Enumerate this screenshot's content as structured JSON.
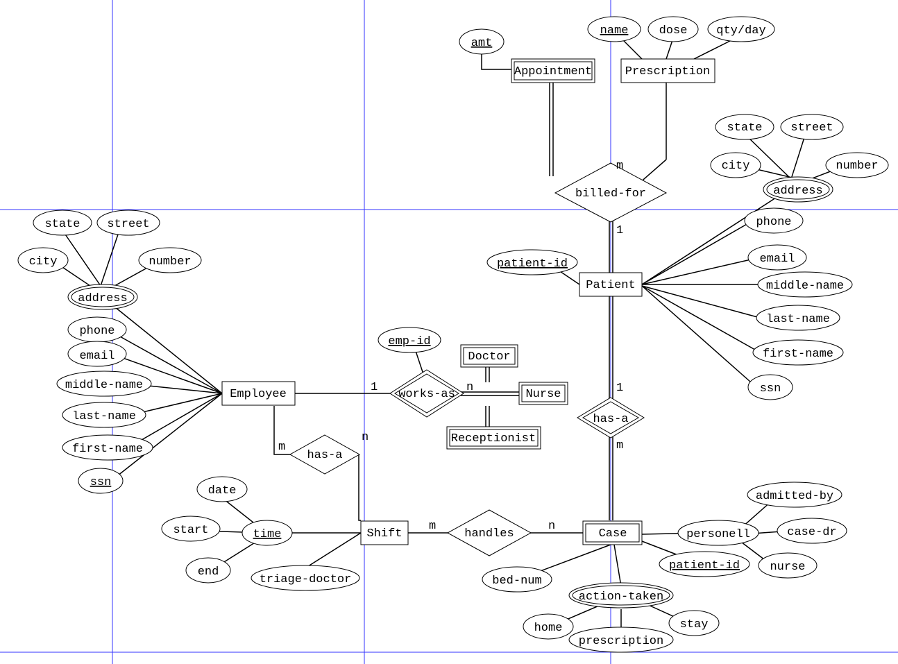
{
  "entities": {
    "appointment": "Appointment",
    "prescription": "Prescription",
    "employee": "Employee",
    "patient": "Patient",
    "shift": "Shift",
    "case": "Case",
    "doctor": "Doctor",
    "nurse": "Nurse",
    "receptionist": "Receptionist"
  },
  "relationships": {
    "billed_for": "billed-for",
    "works_as": "works-as",
    "has_a_emp": "has-a",
    "has_a_pat": "has-a",
    "handles": "handles"
  },
  "attributes": {
    "amt": "amt",
    "name": "name",
    "dose": "dose",
    "qty_day": "qty/day",
    "state1": "state",
    "street1": "street",
    "city1": "city",
    "number1": "number",
    "address1": "address",
    "phone1": "phone",
    "email1": "email",
    "middle_name1": "middle-name",
    "last_name1": "last-name",
    "first_name1": "first-name",
    "ssn1": "ssn",
    "patient_id": "patient-id",
    "state2": "state",
    "street2": "street",
    "city2": "city",
    "number2": "number",
    "address2": "address",
    "phone2": "phone",
    "email2": "email",
    "middle_name2": "middle-name",
    "last_name2": "last-name",
    "first_name2": "first-name",
    "ssn2": "ssn",
    "emp_id": "emp-id",
    "date": "date",
    "start": "start",
    "end": "end",
    "time": "time",
    "triage_doctor": "triage-doctor",
    "bed_num": "bed-num",
    "personell": "personell",
    "admitted_by": "admitted-by",
    "case_dr": "case-dr",
    "nurse_attr": "nurse",
    "patient_id2": "patient-id",
    "action_taken": "action-taken",
    "home": "home",
    "prescription_attr": "prescription",
    "stay": "stay"
  },
  "cardinalities": {
    "m1": "m",
    "one1": "1",
    "one2": "1",
    "n1": "n",
    "m2": "m",
    "n2": "n",
    "m3": "m",
    "n3": "n",
    "one3": "1",
    "m4": "m"
  }
}
